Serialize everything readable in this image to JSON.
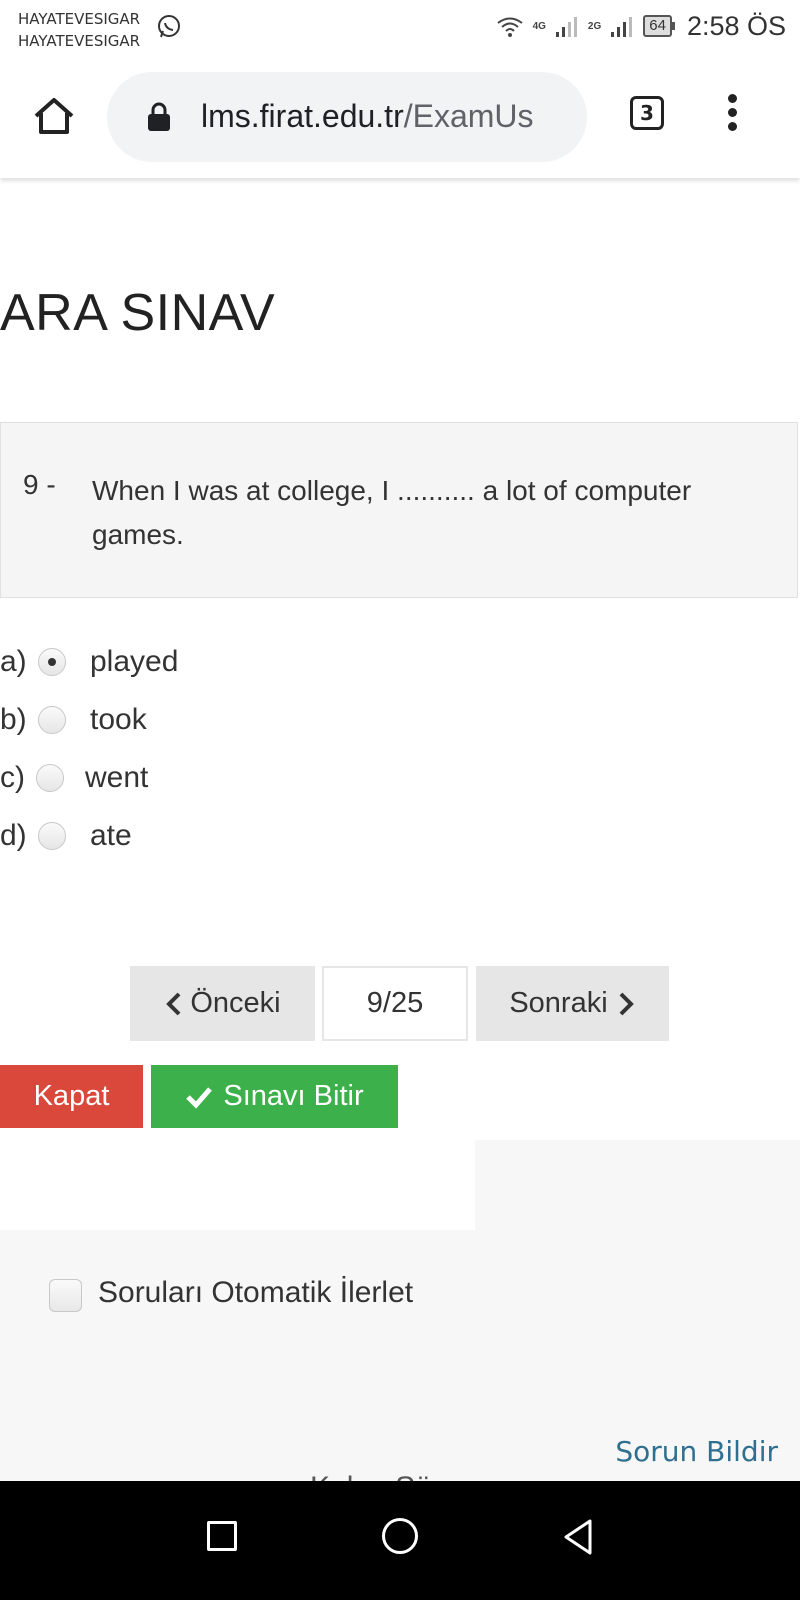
{
  "status_bar": {
    "notification_line_1": "HAYATEVESIGAR",
    "notification_line_2": "HAYATEVESIGAR",
    "notification_icon": "whatsapp-icon",
    "network_1": "4G",
    "network_2": "2G",
    "battery": "64",
    "time": "2:58 ÖS"
  },
  "browser": {
    "url_domain": "lms.firat.edu.tr",
    "url_path": "/ExamUs",
    "tab_count": "3",
    "icons": [
      "home-icon",
      "lock-icon",
      "tabs-icon",
      "more-vert-icon"
    ]
  },
  "exam": {
    "title": "ARA SINAV",
    "question_number": "9 -",
    "question_text": "When I was at college, I .......... a lot of computer games.",
    "options": [
      {
        "letter": "a)",
        "text": "played",
        "selected": true
      },
      {
        "letter": "b)",
        "text": "took",
        "selected": false
      },
      {
        "letter": "c)",
        "text": "went",
        "selected": false
      },
      {
        "letter": "d)",
        "text": "ate",
        "selected": false
      }
    ]
  },
  "navigation": {
    "prev_label": "Önceki",
    "counter": "9/25",
    "next_label": "Sonraki"
  },
  "actions": {
    "close_label": "Kapat",
    "finish_label": "Sınavı Bitir"
  },
  "settings": {
    "auto_advance_label": "Soruları Otomatik İlerlet",
    "report_link": "Sorun Bildir",
    "cutoff_text": "Kalan Süre"
  },
  "colors": {
    "close_button": "#d9483b",
    "finish_button": "#3cb04a",
    "link": "#2f6f8f"
  }
}
